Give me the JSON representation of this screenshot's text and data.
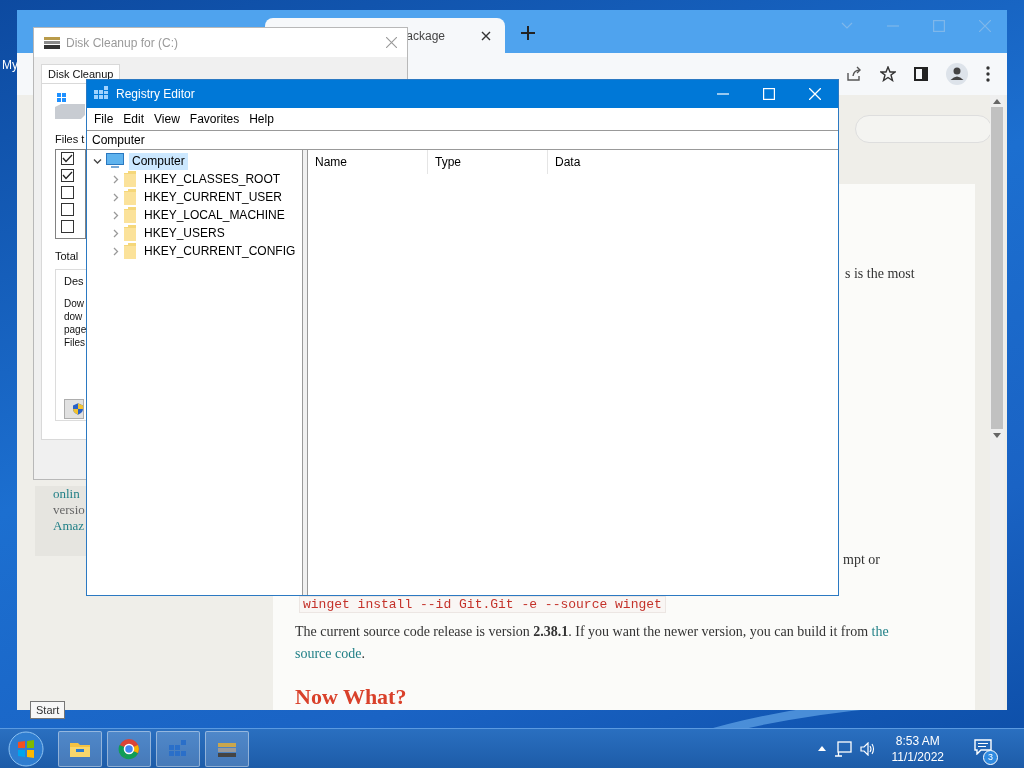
{
  "desktop": {
    "icons": [
      {
        "label": "My"
      }
    ]
  },
  "browser": {
    "tabs": [
      {
        "title": "ackage",
        "selected": true
      }
    ],
    "sidebar_card": {
      "lines": [
        {
          "text": "onlin",
          "kind": "link"
        },
        {
          "text": "versio",
          "kind": "plain"
        },
        {
          "text": "Amaz",
          "kind": "link"
        }
      ]
    },
    "article": {
      "fragments": [
        "s is the most",
        "mpt or"
      ],
      "code": "winget install --id Git.Git -e --source winget",
      "paragraph": {
        "text": "The current source code release is version **2.38.1**. If you want the newer version, you can build it from ",
        "link_lines": [
          "the",
          "source code"
        ],
        "end": "."
      },
      "heading": "Now What?"
    }
  },
  "disk_cleanup": {
    "title": "Disk Cleanup for  (C:)",
    "tabs": [
      {
        "label": "Disk Cleanup",
        "selected": true
      }
    ],
    "files_label": "Files t",
    "items": [
      {
        "checked": true
      },
      {
        "checked": true
      },
      {
        "checked": false
      },
      {
        "checked": false
      },
      {
        "checked": false
      }
    ],
    "total_label": "Total",
    "description_label": "Des",
    "description_lines": [
      "Dow",
      "dow",
      "page",
      "Files"
    ]
  },
  "registry_editor": {
    "title": "Registry Editor",
    "menu": [
      "File",
      "Edit",
      "View",
      "Favorites",
      "Help"
    ],
    "address": "Computer",
    "tree": [
      {
        "label": "Computer",
        "expanded": true,
        "selected": true,
        "children": [
          {
            "label": "HKEY_CLASSES_ROOT",
            "expanded": false,
            "selected": false
          },
          {
            "label": "HKEY_CURRENT_USER",
            "expanded": false,
            "selected": false
          },
          {
            "label": "HKEY_LOCAL_MACHINE",
            "expanded": false,
            "selected": false
          },
          {
            "label": "HKEY_USERS",
            "expanded": false,
            "selected": false
          },
          {
            "label": "HKEY_CURRENT_CONFIG",
            "expanded": false,
            "selected": false
          }
        ]
      }
    ],
    "columns": [
      "Name",
      "Type",
      "Data"
    ]
  },
  "tooltip": "Start",
  "taskbar": {
    "apps": [
      {
        "kind": "explorer"
      },
      {
        "kind": "chrome"
      },
      {
        "kind": "regedit"
      },
      {
        "kind": "cleanup"
      }
    ],
    "time": "8:53 AM",
    "date": "11/1/2022",
    "notification_count": "3"
  }
}
